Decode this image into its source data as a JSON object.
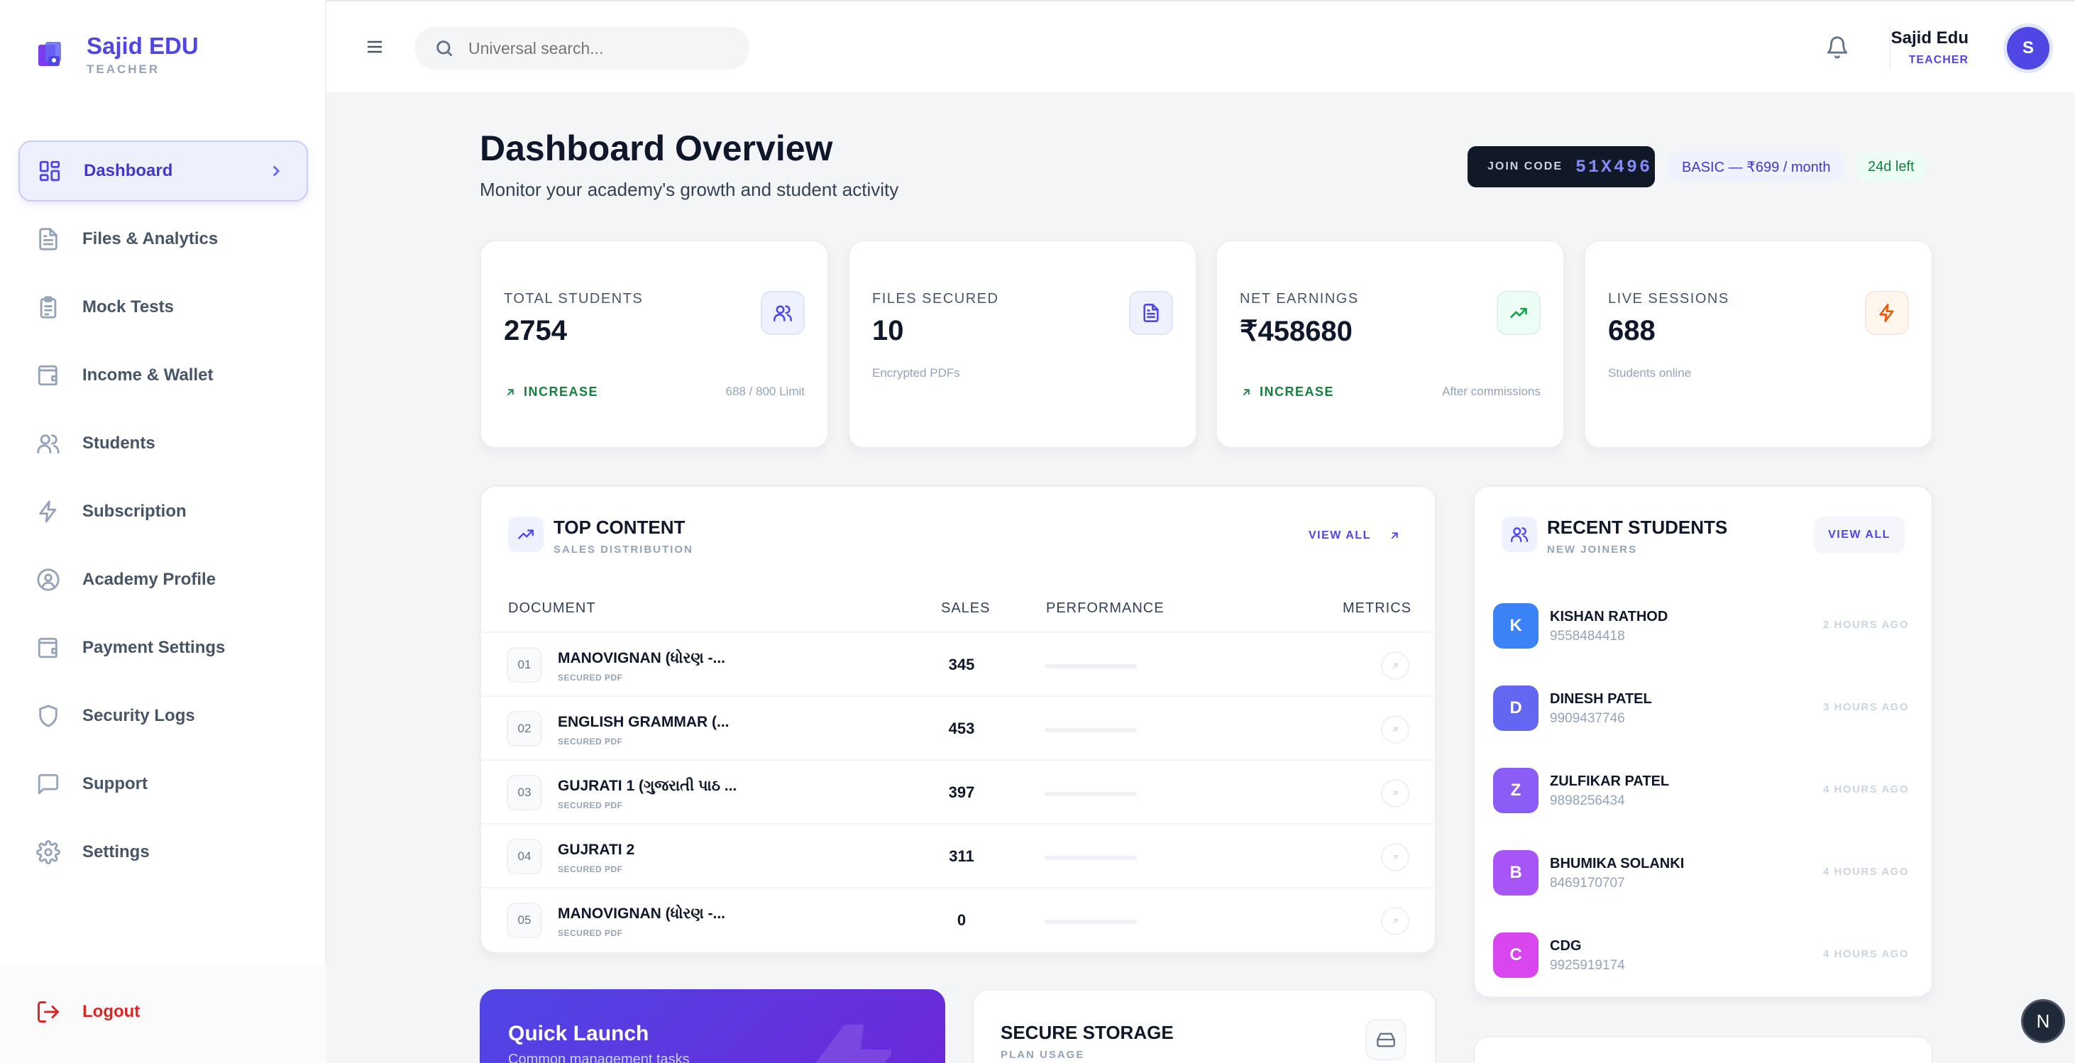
{
  "brand": {
    "name": "Sajid EDU",
    "role": "TEACHER"
  },
  "sidebar": {
    "items": [
      {
        "label": "Dashboard",
        "icon": "dashboard-grid-icon",
        "active": true
      },
      {
        "label": "Files & Analytics",
        "icon": "file-text-icon"
      },
      {
        "label": "Mock Tests",
        "icon": "clipboard-list-icon"
      },
      {
        "label": "Income & Wallet",
        "icon": "wallet-icon"
      },
      {
        "label": "Students",
        "icon": "users-icon"
      },
      {
        "label": "Subscription",
        "icon": "zap-icon"
      },
      {
        "label": "Academy Profile",
        "icon": "user-circle-icon"
      },
      {
        "label": "Payment Settings",
        "icon": "wallet-icon"
      },
      {
        "label": "Security Logs",
        "icon": "shield-icon"
      },
      {
        "label": "Support",
        "icon": "message-square-icon"
      },
      {
        "label": "Settings",
        "icon": "gear-icon"
      }
    ],
    "logout": "Logout"
  },
  "topbar": {
    "search_placeholder": "Universal search...",
    "user_name": "Sajid Edu",
    "user_role": "TEACHER",
    "avatar_initial": "S"
  },
  "header": {
    "title": "Dashboard Overview",
    "subtitle": "Monitor your academy's growth and student activity",
    "join_label": "JOIN CODE",
    "join_code": "51X496",
    "plan": "BASIC — ₹699 / month",
    "days_left": "24d left"
  },
  "stats": [
    {
      "label": "TOTAL STUDENTS",
      "value": "2754",
      "trend": "INCREASE",
      "note": "688 / 800 Limit",
      "icon": "users-icon",
      "accent": "#4f46e5",
      "bg": "#eef2ff"
    },
    {
      "label": "FILES SECURED",
      "value": "10",
      "note": "Encrypted PDFs",
      "icon": "file-text-icon",
      "accent": "#4f46e5",
      "bg": "#eef2ff"
    },
    {
      "label": "NET EARNINGS",
      "value": "₹458680",
      "trend": "INCREASE",
      "note": "After commissions",
      "icon": "trending-up-icon",
      "accent": "#16a34a",
      "bg": "#ecfdf5"
    },
    {
      "label": "LIVE SESSIONS",
      "value": "688",
      "note": "Students online",
      "icon": "zap-icon",
      "accent": "#ea580c",
      "bg": "#fff7ed"
    }
  ],
  "top_content": {
    "title": "TOP CONTENT",
    "subtitle": "SALES DISTRIBUTION",
    "view_all": "VIEW ALL",
    "columns": [
      "DOCUMENT",
      "SALES",
      "PERFORMANCE",
      "METRICS"
    ],
    "rows": [
      {
        "rank": "01",
        "name": "MANOVIGNAN (ધોરણ -...",
        "sub": "SECURED PDF",
        "sales": "345",
        "performance": 0
      },
      {
        "rank": "02",
        "name": "ENGLISH GRAMMAR (...",
        "sub": "SECURED PDF",
        "sales": "453",
        "performance": 0
      },
      {
        "rank": "03",
        "name": "GUJRATI 1 (ગુજરાતી પાઠ ...",
        "sub": "SECURED PDF",
        "sales": "397",
        "performance": 0
      },
      {
        "rank": "04",
        "name": "GUJRATI 2",
        "sub": "SECURED PDF",
        "sales": "311",
        "performance": 0
      },
      {
        "rank": "05",
        "name": "MANOVIGNAN (ધોરણ -...",
        "sub": "SECURED PDF",
        "sales": "0",
        "performance": 0
      }
    ]
  },
  "recent_students": {
    "title": "RECENT STUDENTS",
    "subtitle": "NEW JOINERS",
    "view_all": "VIEW ALL",
    "items": [
      {
        "initial": "K",
        "name": "KISHAN RATHOD",
        "phone": "9558484418",
        "time": "2 HOURS AGO",
        "color": "#3b82f6"
      },
      {
        "initial": "D",
        "name": "DINESH PATEL",
        "phone": "9909437746",
        "time": "3 HOURS AGO",
        "color": "#6366f1"
      },
      {
        "initial": "Z",
        "name": "ZULFIKAR PATEL",
        "phone": "9898256434",
        "time": "4 HOURS AGO",
        "color": "#8b5cf6"
      },
      {
        "initial": "B",
        "name": "BHUMIKA SOLANKI",
        "phone": "8469170707",
        "time": "4 HOURS AGO",
        "color": "#a855f7"
      },
      {
        "initial": "C",
        "name": "CDG",
        "phone": "9925919174",
        "time": "4 HOURS AGO",
        "color": "#d946ef"
      }
    ]
  },
  "quick_launch": {
    "title": "Quick Launch",
    "subtitle": "Common management tasks"
  },
  "storage": {
    "title": "SECURE STORAGE",
    "subtitle": "PLAN USAGE"
  },
  "dev_badge": "N"
}
